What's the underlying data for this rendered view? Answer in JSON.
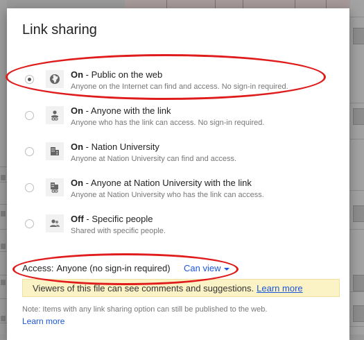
{
  "dialog": {
    "title": "Link sharing"
  },
  "options": [
    {
      "state": "On",
      "label": " - Public on the web",
      "description": "Anyone on the Internet can find and access. No sign-in required.",
      "icon": "globe-icon",
      "selected": true
    },
    {
      "state": "On",
      "label": " - Anyone with the link",
      "description": "Anyone who has the link can access. No sign-in required.",
      "icon": "person-link-icon",
      "selected": false
    },
    {
      "state": "On",
      "label": " - Nation University",
      "description": "Anyone at Nation University can find and access.",
      "icon": "building-icon",
      "selected": false
    },
    {
      "state": "On",
      "label": " - Anyone at Nation University with the link",
      "description": "Anyone at Nation University who has the link can access.",
      "icon": "building-link-icon",
      "selected": false
    },
    {
      "state": "Off",
      "label": " - Specific people",
      "description": "Shared with specific people.",
      "icon": "people-icon",
      "selected": false
    }
  ],
  "access": {
    "label": "Access:",
    "value": "Anyone (no sign-in required)",
    "permission": "Can view"
  },
  "notice": {
    "text": "Viewers of this file can see comments and suggestions.",
    "link": "Learn more"
  },
  "footer": {
    "note": "Note: Items with any link sharing option can still be published to the web.",
    "link": "Learn more"
  },
  "colors": {
    "link": "#1a56db",
    "annotation": "#e01b1b",
    "notice_bg": "#fbf2c6"
  }
}
